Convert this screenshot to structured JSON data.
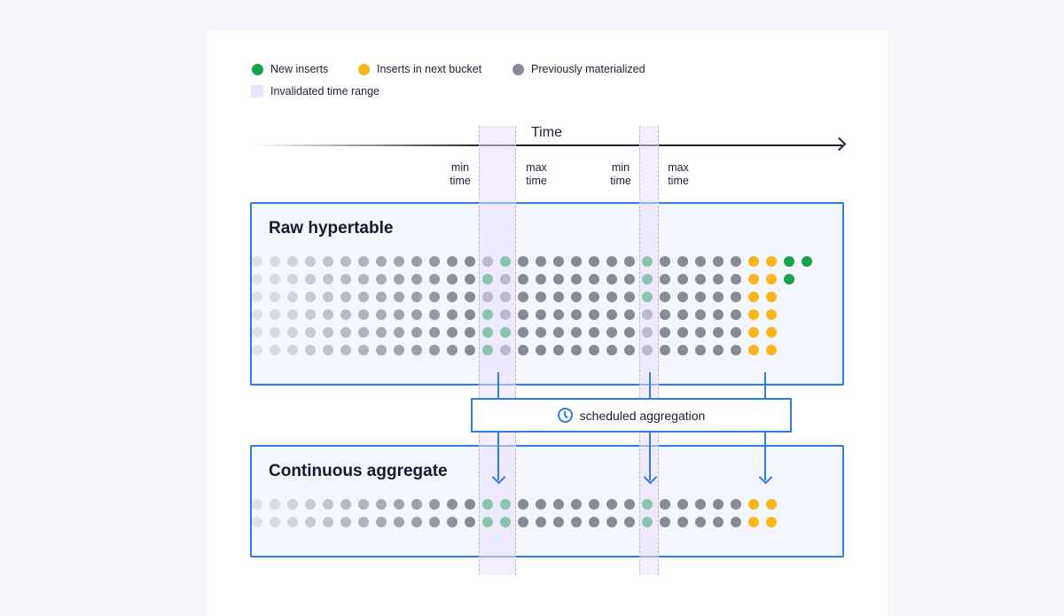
{
  "legend": [
    {
      "label": "New inserts",
      "color": "#17a44c",
      "shape": "dot"
    },
    {
      "label": "Inserts in next bucket",
      "color": "#fbb41a",
      "shape": "dot"
    },
    {
      "label": "Previously materialized",
      "color": "#878b97",
      "shape": "dot"
    },
    {
      "label": "Invalidated time range",
      "color": "#ece3fc",
      "shape": "square"
    }
  ],
  "axis": {
    "label": "Time"
  },
  "ticks": [
    {
      "line1": "min",
      "line2": "time"
    },
    {
      "line1": "max",
      "line2": "time"
    },
    {
      "line1": "min",
      "line2": "time"
    },
    {
      "line1": "max",
      "line2": "time"
    }
  ],
  "raw": {
    "title": "Raw hypertable",
    "rows": [
      "PPPPPPPPPPPPPPNPPPPPPPNPPPPPYYNN",
      "PPPPPPPPPPPPPNPPPPPPPPNPPPPPYYN",
      "PPPPPPPPPPPPPPPPPPPPPPNPPPPPYY",
      "PPPPPPPPPPPPPNPPPPPPPPPPPPPPYY",
      "PPPPPPPPPPPPPNNPPPPPPPPPPPPPYY",
      "PPPPPPPPPPPPPNPPPPPPPPPPPPPPYY"
    ]
  },
  "aggregate": {
    "title": "Continuous aggregate",
    "rows": [
      "PPPPPPPPPPPPPNNPPPPPPPNPPPPPYY",
      "PPPPPPPPPPPPPNNPPPPPPPNPPPPPYY"
    ]
  },
  "process": {
    "label": "scheduled aggregation",
    "icon": "clock-icon"
  },
  "colors": {
    "N": "#17a44c",
    "Y": "#fbb41a",
    "P": "#878b97",
    "accent": "#2f7de1"
  }
}
